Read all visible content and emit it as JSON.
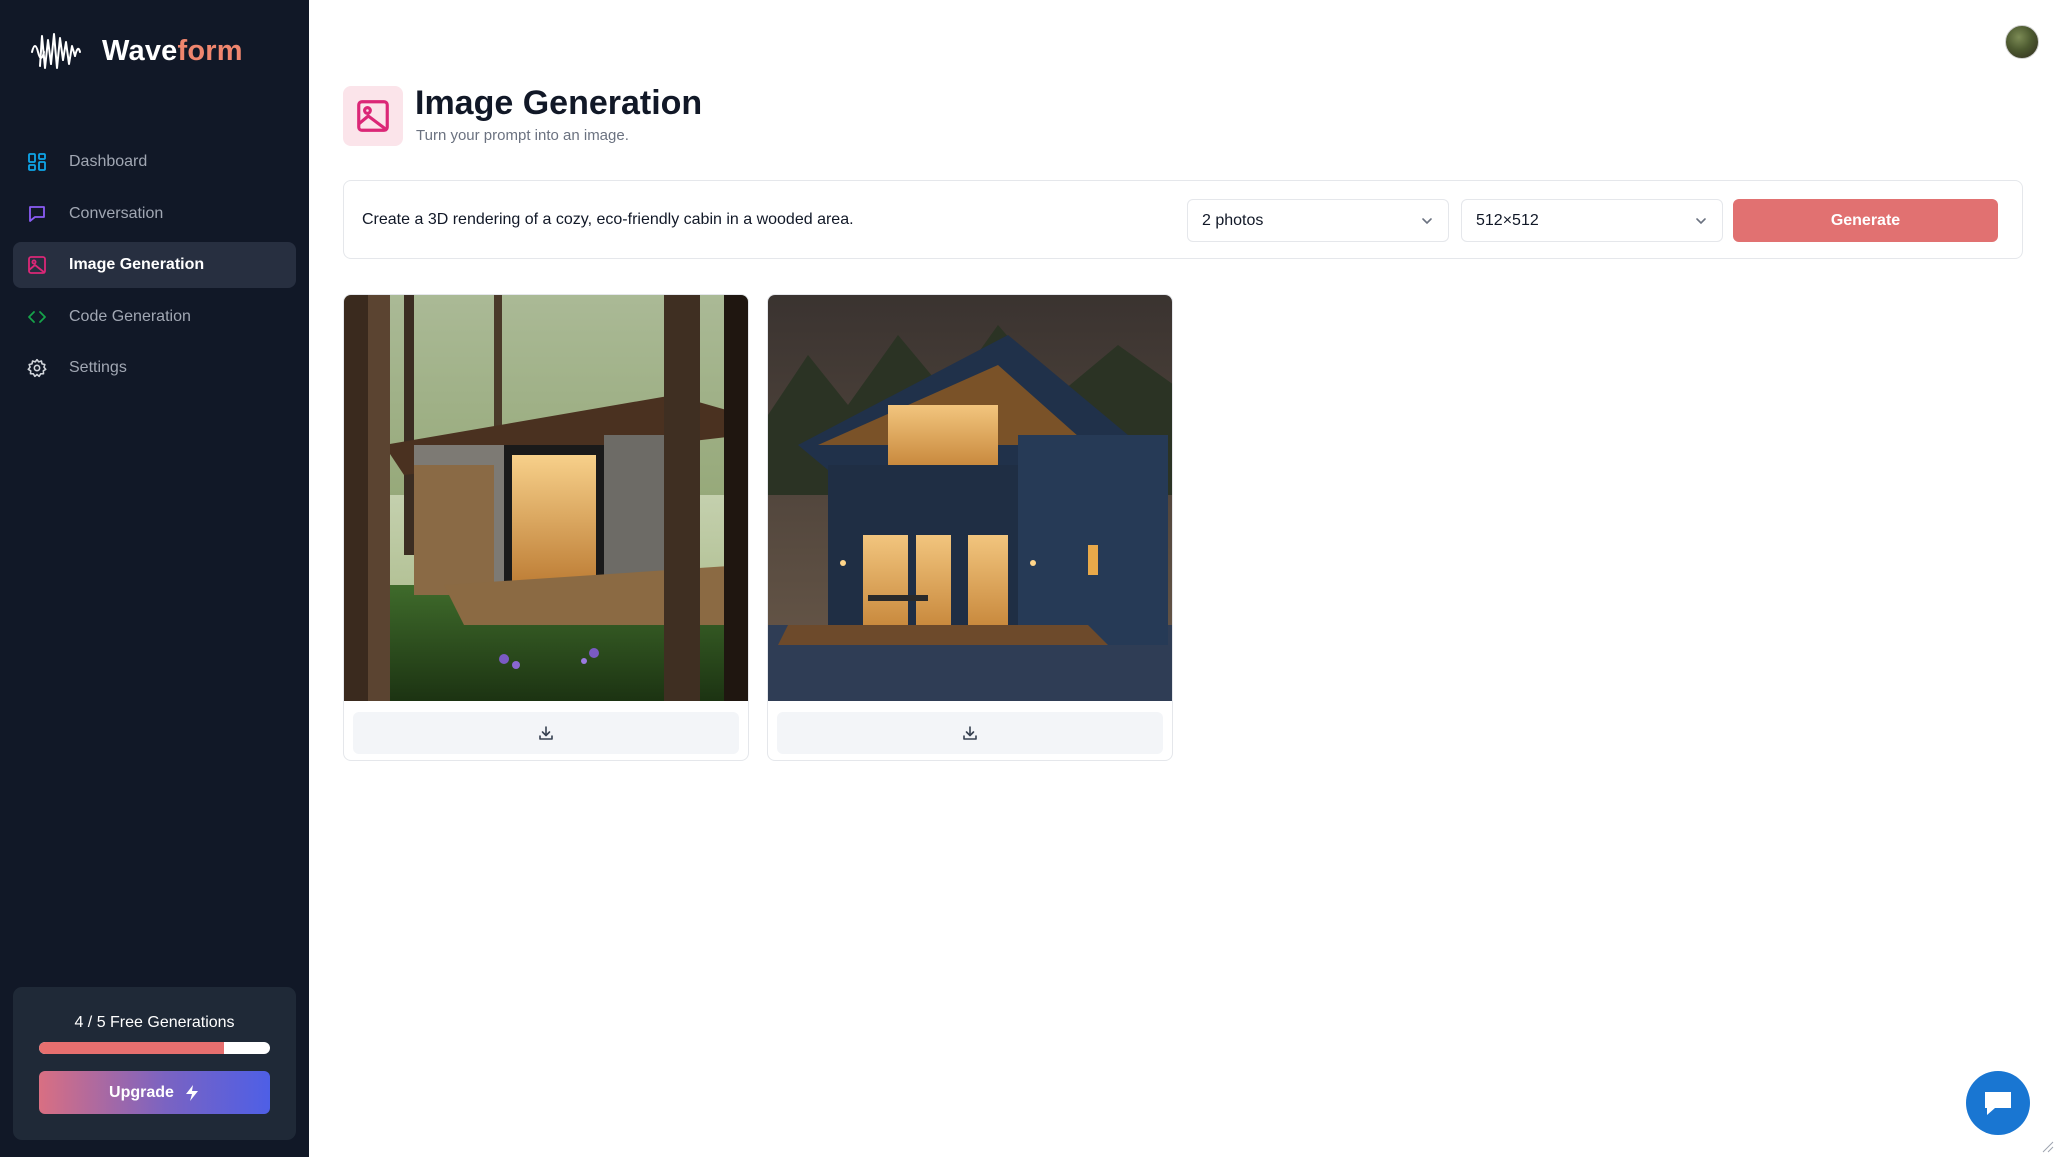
{
  "app": {
    "name_part1": "Wave",
    "name_part2": "form",
    "brand_accent": "#f0866e"
  },
  "sidebar": {
    "items": [
      {
        "label": "Dashboard",
        "icon": "dashboard-icon",
        "color": "#0ea5e9"
      },
      {
        "label": "Conversation",
        "icon": "chat-icon",
        "color": "#8b5cf6"
      },
      {
        "label": "Image Generation",
        "icon": "image-icon",
        "color": "#db2777",
        "active": true
      },
      {
        "label": "Code Generation",
        "icon": "code-icon",
        "color": "#16a34a"
      },
      {
        "label": "Settings",
        "icon": "gear-icon",
        "color": "#d1d5db"
      }
    ]
  },
  "usage": {
    "text": "4 / 5 Free Generations",
    "used": 4,
    "limit": 5,
    "upgrade_label": "Upgrade"
  },
  "page": {
    "title": "Image Generation",
    "subtitle": "Turn your prompt into an image."
  },
  "form": {
    "prompt_value": "Create a 3D rendering of a cozy, eco-friendly cabin in a wooded area.",
    "amount_value": "2 photos",
    "resolution_value": "512×512",
    "generate_label": "Generate",
    "generate_color": "#e17171"
  },
  "results": [
    {
      "icon": "download-icon"
    },
    {
      "icon": "download-icon"
    }
  ]
}
